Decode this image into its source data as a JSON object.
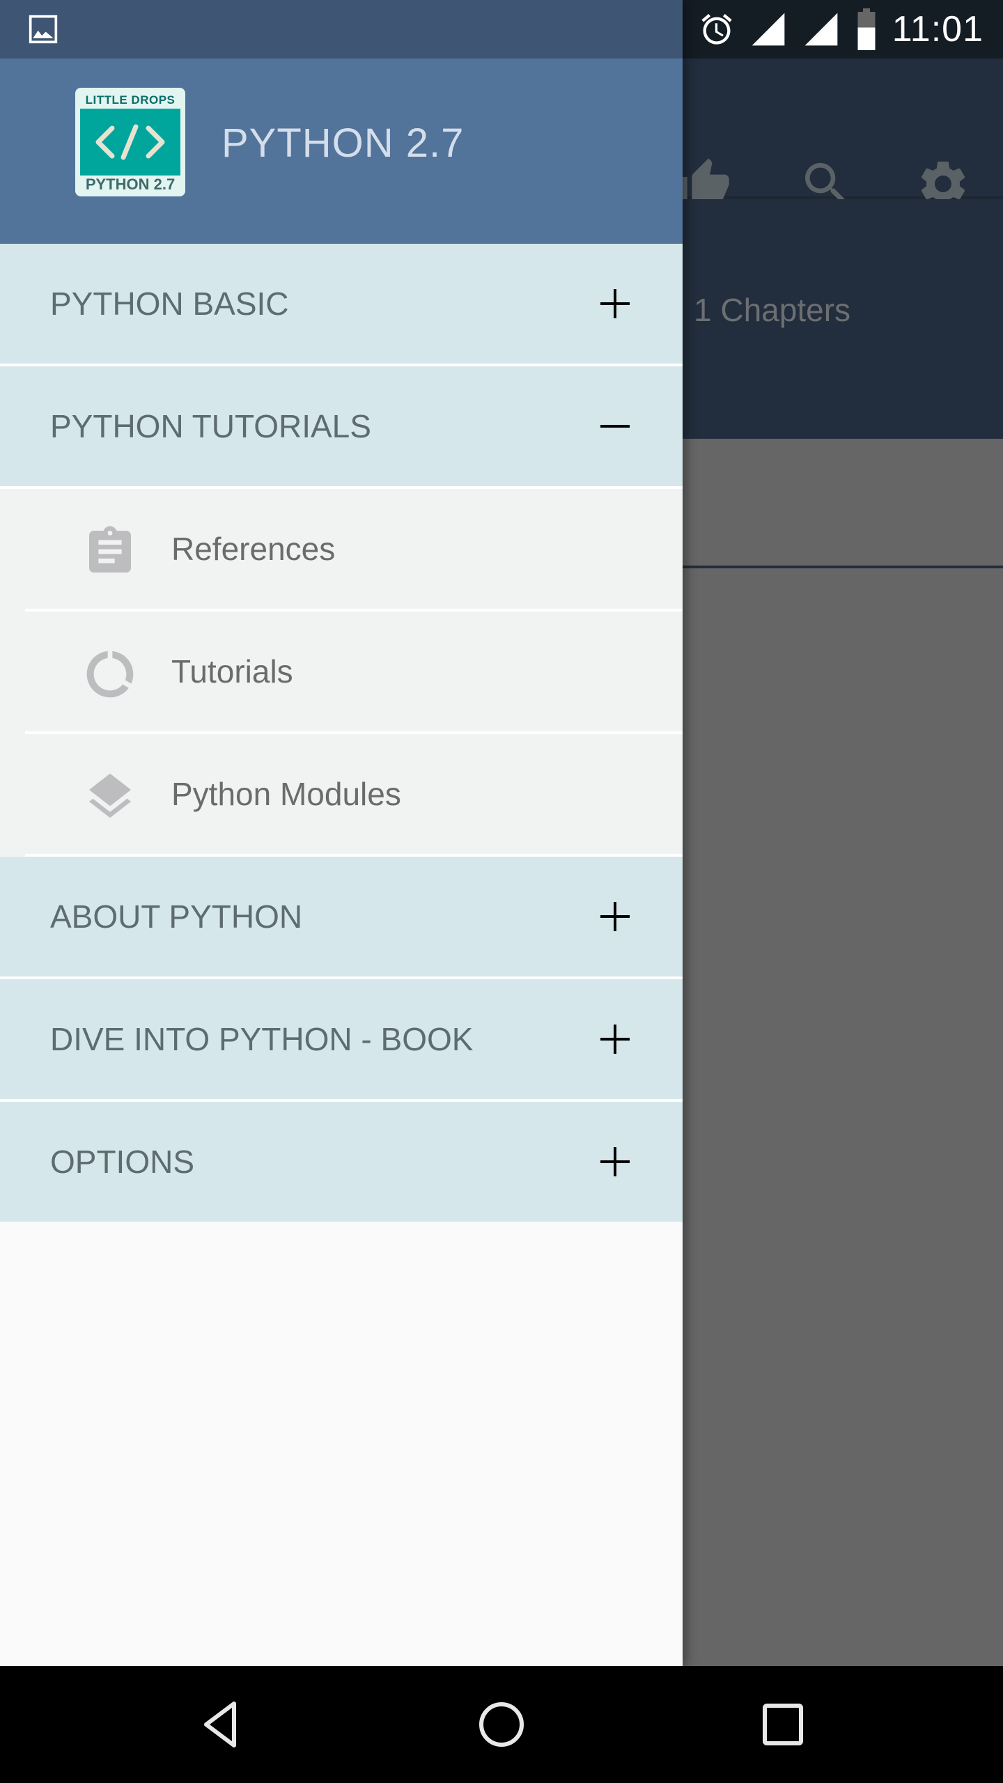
{
  "status_bar": {
    "time": "11:01",
    "icons": [
      "image-notification-icon",
      "alarm-icon",
      "signal-icon",
      "signal-icon",
      "battery-icon"
    ]
  },
  "drawer": {
    "logo": {
      "top_text": "LITTLE DROPS",
      "symbol": "</>",
      "bottom_text": "PYTHON 2.7"
    },
    "title": "PYTHON 2.7",
    "groups": [
      {
        "label": "PYTHON BASIC",
        "toggle": "+",
        "expanded": false
      },
      {
        "label": "PYTHON TUTORIALS",
        "toggle": "−",
        "expanded": true,
        "items": [
          {
            "label": "References",
            "icon": "clipboard-icon"
          },
          {
            "label": "Tutorials",
            "icon": "progress-circle-icon"
          },
          {
            "label": "Python Modules",
            "icon": "layers-icon"
          }
        ]
      },
      {
        "label": "ABOUT PYTHON",
        "toggle": "+",
        "expanded": false
      },
      {
        "label": "DIVE INTO PYTHON - BOOK",
        "toggle": "+",
        "expanded": false
      },
      {
        "label": "OPTIONS",
        "toggle": "+",
        "expanded": false
      }
    ]
  },
  "background_app": {
    "toolbar_icons": [
      "thumbs-up-icon",
      "search-icon",
      "settings-icon"
    ],
    "chapters_text": "1 Chapters"
  },
  "nav_bar": {
    "buttons": [
      "back",
      "home",
      "recents"
    ]
  },
  "colors": {
    "drawer_header": "#52739A",
    "drawer_status": "#3E5673",
    "group_bg": "#D5E7EA",
    "sub_bg": "#F1F3F3",
    "logo_teal": "#00A69B"
  }
}
